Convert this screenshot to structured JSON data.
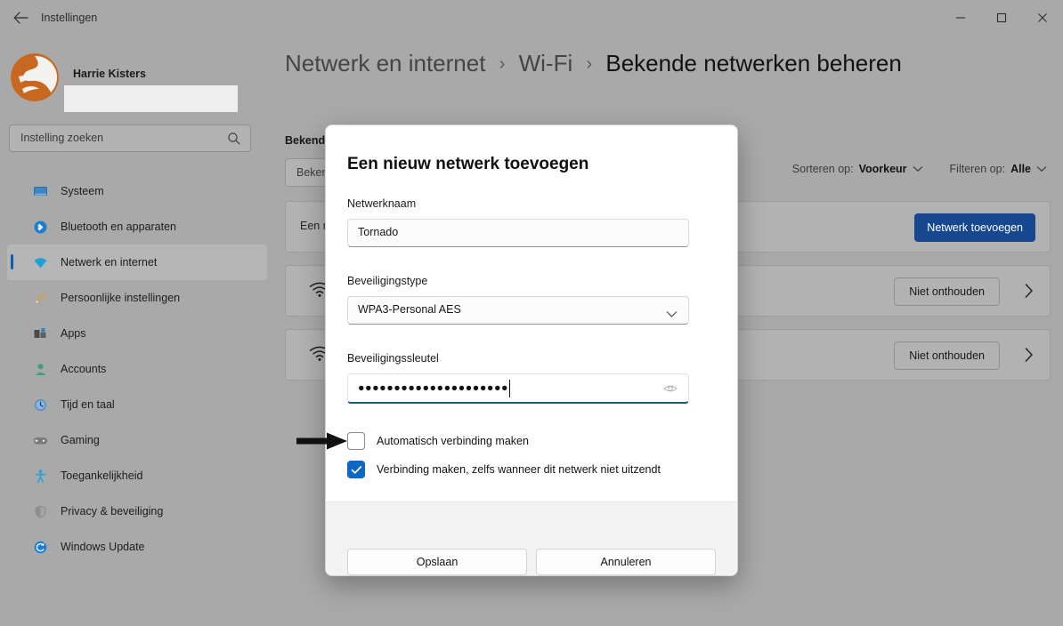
{
  "window": {
    "title": "Instellingen",
    "back_icon": "back-arrow-icon",
    "minimize_label": "—",
    "maximize_label": "□",
    "close_label": "✕"
  },
  "sidebar": {
    "profile": {
      "name": "Harrie Kisters",
      "avatar_icon": "user-avatar-logo",
      "redacted_email": ""
    },
    "search": {
      "placeholder": "Instelling zoeken",
      "icon": "search-icon"
    },
    "items": [
      {
        "label": "Systeem",
        "icon": "system-icon",
        "selected": false
      },
      {
        "label": "Bluetooth en apparaten",
        "icon": "bluetooth-icon",
        "selected": false
      },
      {
        "label": "Netwerk en internet",
        "icon": "network-icon",
        "selected": true
      },
      {
        "label": "Persoonlijke instellingen",
        "icon": "personalization-brush-icon",
        "selected": false
      },
      {
        "label": "Apps",
        "icon": "apps-icon",
        "selected": false
      },
      {
        "label": "Accounts",
        "icon": "accounts-person-icon",
        "selected": false
      },
      {
        "label": "Tijd en taal",
        "icon": "clock-icon",
        "selected": false
      },
      {
        "label": "Gaming",
        "icon": "gamepad-icon",
        "selected": false
      },
      {
        "label": "Toegankelijkheid",
        "icon": "accessibility-icon",
        "selected": false
      },
      {
        "label": "Privacy & beveiliging",
        "icon": "shield-icon",
        "selected": false
      },
      {
        "label": "Windows Update",
        "icon": "update-refresh-icon",
        "selected": false
      }
    ]
  },
  "main": {
    "breadcrumb": {
      "part1": "Netwerk en internet",
      "sep1": "›",
      "part2": "Wi-Fi",
      "sep2": "›",
      "current": "Bekende netwerken beheren"
    },
    "section_title": "Bekende netwerken",
    "list_search_placeholder": "Bekende netwerken zoeken",
    "sort": {
      "label": "Sorteren op:",
      "value": "Voorkeur",
      "icon": "chevron-down-icon"
    },
    "filter": {
      "label": "Filteren op:",
      "value": "Alle",
      "icon": "chevron-down-icon"
    },
    "cards": [
      {
        "label": "Een nieuw netwerk toevoegen",
        "action_label": "Netwerk toevoegen",
        "icon": "",
        "kind": "add"
      },
      {
        "label": "",
        "action_label": "Niet onthouden",
        "icon": "wifi-icon",
        "chevron": "chevron-right-icon",
        "kind": "network"
      },
      {
        "label": "",
        "action_label": "Niet onthouden",
        "icon": "wifi-icon",
        "chevron": "chevron-right-icon",
        "kind": "network"
      }
    ]
  },
  "dialog": {
    "title": "Een nieuw netwerk toevoegen",
    "network_name": {
      "label": "Netwerknaam",
      "value": "Tornado"
    },
    "security_type": {
      "label": "Beveiligingstype",
      "value": "WPA3-Personal AES",
      "icon": "chevron-down-icon"
    },
    "security_key": {
      "label": "Beveiligingssleutel",
      "value": "●●●●●●●●●●●●●●●●●●●●●",
      "reveal_icon": "eye-icon",
      "focused": true
    },
    "checkbox_autoconnect": {
      "label": "Automatisch verbinding maken",
      "checked": false
    },
    "checkbox_hidden": {
      "label": "Verbinding maken, zelfs wanneer dit netwerk niet uitzendt",
      "checked": true
    },
    "save_label": "Opslaan",
    "cancel_label": "Annuleren"
  },
  "annotation": {
    "arrow_icon": "pointer-arrow-icon",
    "target": "checkbox_autoconnect"
  },
  "colors": {
    "accent_blue": "#0a68c4",
    "primary_button": "#17478f",
    "selected_indicator": "#0b5db8",
    "focus_underline": "#1b5c78",
    "window_bg": "#a9a9a9",
    "dialog_bg": "#ffffff"
  }
}
